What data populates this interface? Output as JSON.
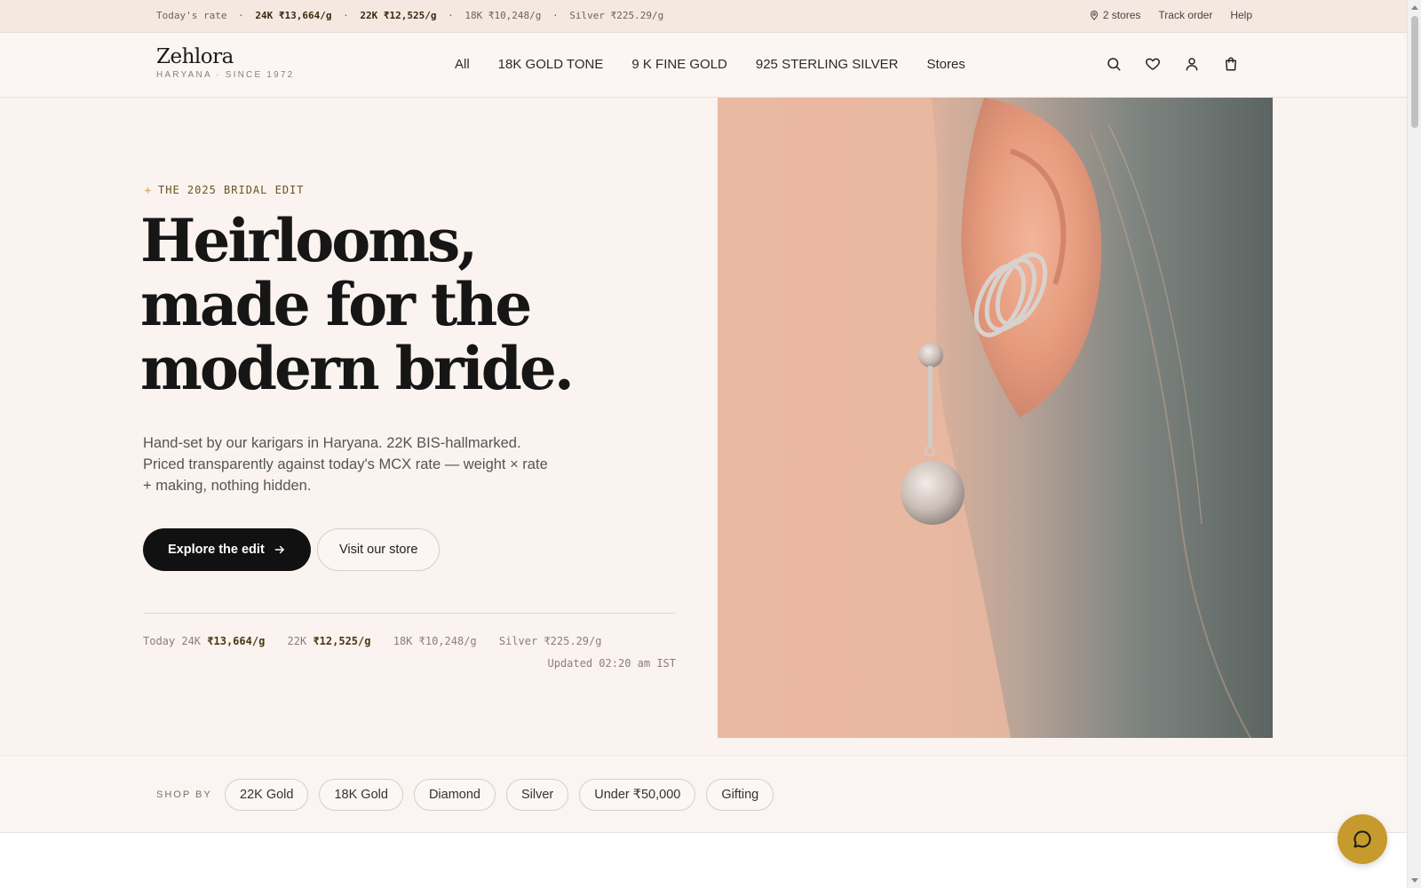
{
  "ratebar": {
    "label": "Today's rate",
    "r24_label": "24K",
    "r24_value": "₹13,664/g",
    "r22_label": "22K",
    "r22_value": "₹12,525/g",
    "r18": "18K ₹10,248/g",
    "silver": "Silver ₹225.29/g",
    "sep": "·",
    "links": {
      "stores": "2 stores",
      "track": "Track order",
      "help": "Help"
    }
  },
  "header": {
    "brand": "Zehlora",
    "tagline": "HARYANA · SINCE 1972",
    "nav": [
      "All",
      "18K GOLD TONE",
      "9 K FINE GOLD",
      "925 STERLING SILVER",
      "Stores"
    ],
    "icons": [
      "search-icon",
      "heart-icon",
      "user-icon",
      "bag-icon"
    ]
  },
  "hero": {
    "eyebrow": "THE 2025 BRIDAL EDIT",
    "headline": "Heirlooms, made for the modern bride.",
    "sub": "Hand-set by our karigars in Haryana. 22K BIS-hallmarked. Priced transparently against today's MCX rate — weight × rate + making, nothing hidden.",
    "cta_primary": "Explore the edit",
    "cta_secondary": "Visit our store",
    "rates": {
      "today_label": "Today 24K",
      "v24": "₹13,664/g",
      "k22_label": "22K",
      "v22": "₹12,525/g",
      "k18": "18K ₹10,248/g",
      "silver": "Silver ₹225.29/g",
      "updated": "Updated 02:20 am IST"
    }
  },
  "shopby": {
    "label": "SHOP BY",
    "chips": [
      "22K Gold",
      "18K Gold",
      "Diamond",
      "Silver",
      "Under ₹50,000",
      "Gifting"
    ]
  },
  "colors": {
    "accent": "#c69a2c",
    "primary_button": "#111111",
    "hero_bg": "#faf3ef",
    "ratebar_bg": "#f5e8e0"
  }
}
